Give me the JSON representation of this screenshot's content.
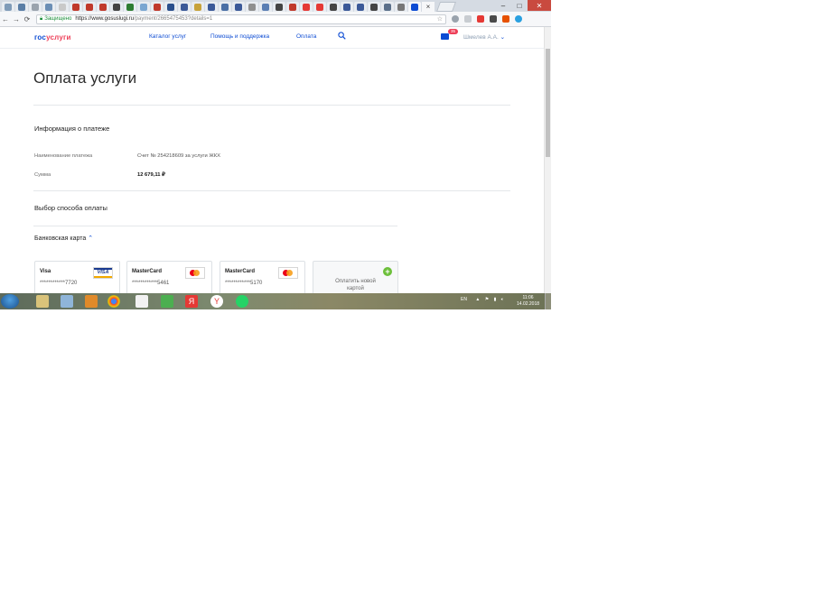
{
  "browser": {
    "secure_label": "Защищено",
    "url_host": "https://www.gosuslugi.ru",
    "url_path": "/payment/2665475453?details=1",
    "tab_close": "×",
    "tab_count": 33
  },
  "header": {
    "logo_part1": "гос",
    "logo_part2": "услуги",
    "nav": [
      "Каталог услуг",
      "Помощь и поддержка",
      "Оплата"
    ],
    "mail_badge": "35",
    "user_name": "Шмелев А.А."
  },
  "page": {
    "title": "Оплата услуги",
    "payment_info_heading": "Информация о платеже",
    "fields": [
      {
        "label": "Наименование платежа",
        "value": "Счет № 254218609 за услуги ЖКХ"
      },
      {
        "label": "Сумма",
        "value": "12 679,11 ₽"
      }
    ],
    "method_heading": "Выбор способа оплаты",
    "bank_card_section": "Банковская карта"
  },
  "cards": [
    {
      "brand": "Visa",
      "number": "************7720"
    },
    {
      "brand": "MasterCard",
      "number": "************5461"
    },
    {
      "brand": "MasterCard",
      "number": "************5170"
    }
  ],
  "new_card": {
    "line1": "Оплатить новой",
    "line2": "картой"
  },
  "taskbar": {
    "lang": "EN",
    "time": "11:06",
    "date": "14.02.2018"
  },
  "colors": {
    "brand_blue": "#0d4cd3",
    "brand_red": "#ee3f58",
    "add_green": "#6cbf3a"
  }
}
